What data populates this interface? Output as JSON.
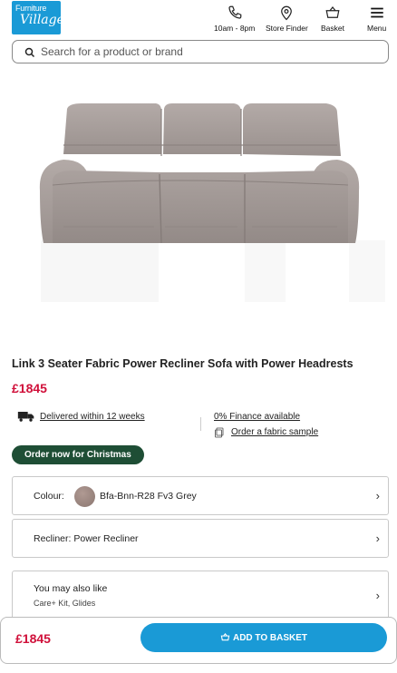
{
  "brand": {
    "line1": "Furniture",
    "line2": "Village",
    "color": "#1a9ad6"
  },
  "header": {
    "items": [
      {
        "label": "10am - 8pm",
        "icon": "phone-icon"
      },
      {
        "label": "Store Finder",
        "icon": "location-pin-icon"
      },
      {
        "label": "Basket",
        "icon": "basket-icon"
      },
      {
        "label": "Menu",
        "icon": "hamburger-menu-icon"
      }
    ]
  },
  "search": {
    "placeholder": "Search for a product or brand",
    "value": ""
  },
  "product": {
    "title": "Link 3 Seater Fabric Power Recliner Sofa with Power Headrests",
    "price": "£1845",
    "delivery": "Delivered within 12 weeks",
    "finance": "0% Finance available",
    "sample": "Order a fabric sample",
    "badge": "Order now for Christmas"
  },
  "options": {
    "colour_label": "Colour:",
    "colour_value": "Bfa-Bnn-R28 Fv3 Grey",
    "recliner": "Recliner: Power Recliner",
    "also_like_title": "You may also like",
    "also_like_items": "Care+ Kit, Glides"
  },
  "sticky": {
    "price": "£1845",
    "add_label": "ADD TO BASKET"
  },
  "colors": {
    "accent": "#1a9ad6",
    "price": "#d0103a",
    "badge": "#1e4e35"
  }
}
